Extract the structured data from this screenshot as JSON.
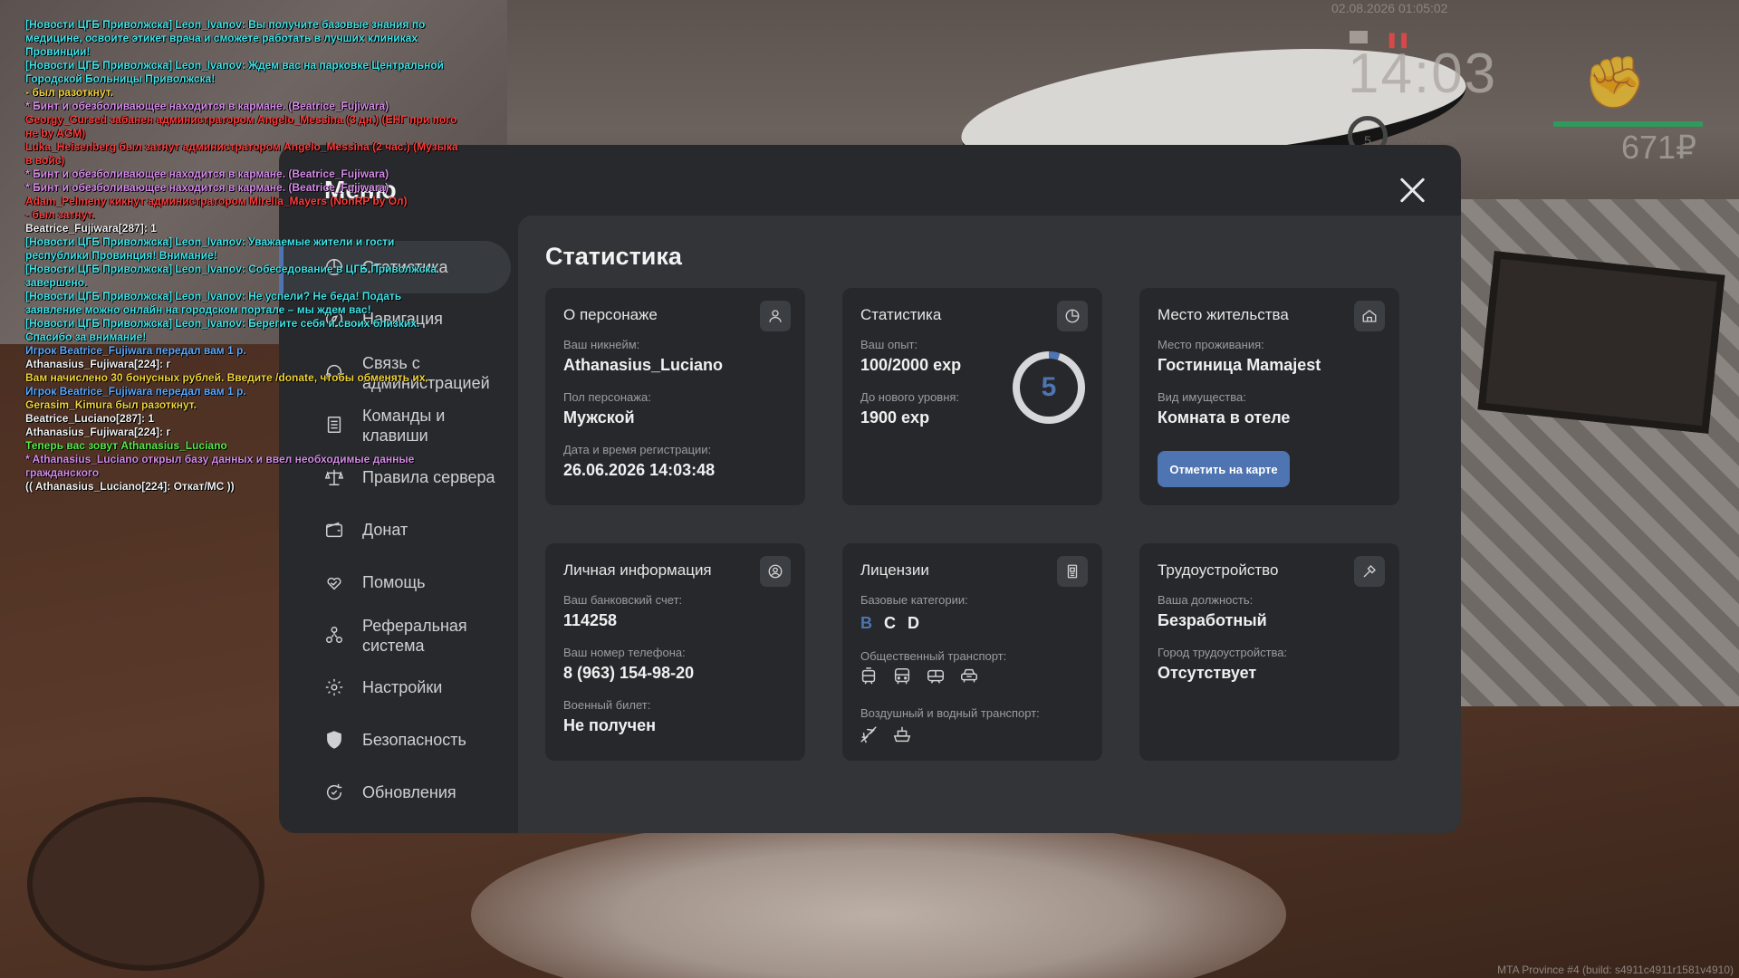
{
  "hud": {
    "datetime": "02.08.2026 01:05:02",
    "time": "14:03",
    "level": "5",
    "exp": "100/2000",
    "money": "671₽",
    "build": "MTA Province #4 (build: s4911c4911r1581v4910)"
  },
  "chat": [
    {
      "text": "[Новости ЦГБ Приволжска] Leon_Ivanov: Вы получите базовые знания по медицине, освоите этикет врача и сможете работать в лучших клиниках Провинции!",
      "color": "#3fe3e8"
    },
    {
      "text": "[Новости ЦГБ Приволжска] Leon_Ivanov: Ждем вас на парковке Центральной Городской Больницы Приволжска!",
      "color": "#3fe3e8"
    },
    {
      "text": "- был разоткнут.",
      "color": "#f2d43a"
    },
    {
      "text": "* Бинт и обезболивающее находится в кармане. (Beatrice_Fujiwara)",
      "color": "#d58be8"
    },
    {
      "text": "Georgy_Cursed забанен администратором Angelo_Messina (3 дн.) (ЕНГ при пого не by AGM)",
      "color": "#ff3b3b"
    },
    {
      "text": "Luka_Heisenberg был затнут администратором Angelo_Messina (2 час.) (Музыка в войс)",
      "color": "#ff3b3b"
    },
    {
      "text": "* Бинт и обезболивающее находится в кармане. (Beatrice_Fujiwara)",
      "color": "#d58be8"
    },
    {
      "text": "* Бинт и обезболивающее находится в кармане. (Beatrice_Fujiwara)",
      "color": "#d58be8"
    },
    {
      "text": "Adam_Pelmeny кикнут администратором Mirella_Mayers (NonRP by Ол)",
      "color": "#ff3b3b"
    },
    {
      "text": "- был затнут.",
      "color": "#ff3b3b"
    },
    {
      "text": "Beatrice_Fujiwara[287]: 1",
      "color": "#f2f2f2"
    },
    {
      "text": "[Новости ЦГБ Приволжска] Leon_Ivanov: Уважаемые жители и гости республики Провинция! Внимание!",
      "color": "#3fe3e8"
    },
    {
      "text": "[Новости ЦГБ Приволжска] Leon_Ivanov: Собеседование в ЦГБ Приволжска завершено.",
      "color": "#3fe3e8"
    },
    {
      "text": "[Новости ЦГБ Приволжска] Leon_Ivanov: Не успели? Не беда! Подать заявление можно онлайн на городском портале – мы ждем вас!",
      "color": "#3fe3e8"
    },
    {
      "text": "[Новости ЦГБ Приволжска] Leon_Ivanov: Берегите себя и своих близких. Спасибо за внимание!",
      "color": "#3fe3e8"
    },
    {
      "text": "Игрок Beatrice_Fujiwara передал вам 1 р.",
      "color": "#5aa8ff"
    },
    {
      "text": "Athanasius_Fujiwara[224]: г",
      "color": "#f2f2f2"
    },
    {
      "text": "Вам начислено 30 бонусных рублей. Введите /donate, чтобы обменять их.",
      "color": "#f2d43a"
    },
    {
      "text": "Игрок Beatrice_Fujiwara передал вам 1 р.",
      "color": "#5aa8ff"
    },
    {
      "text": "Gerasim_Kimura был разоткнут.",
      "color": "#f2d43a"
    },
    {
      "text": "Beatrice_Luciano[287]: 1",
      "color": "#f2f2f2"
    },
    {
      "text": "Athanasius_Fujiwara[224]: г",
      "color": "#f2f2f2"
    },
    {
      "text": "Теперь вас зовут Athanasius_Luciano",
      "color": "#5bea4a"
    },
    {
      "text": "* Athanasius_Luciano открыл базу данных и ввел необходимые данные гражданского",
      "color": "#d58be8"
    },
    {
      "text": "(( Athanasius_Luciano[224]: Откат/МС ))",
      "color": "#f2f2f2"
    }
  ],
  "menu": {
    "title": "Меню",
    "nav": [
      {
        "label": "Статистика",
        "icon": "pie-chart-icon",
        "active": true
      },
      {
        "label": "Навигация",
        "icon": "compass-icon"
      },
      {
        "label": "Связь с администрацией",
        "icon": "headset-icon"
      },
      {
        "label": "Команды и клавиши",
        "icon": "document-list-icon"
      },
      {
        "label": "Правила сервера",
        "icon": "scales-icon"
      },
      {
        "label": "Донат",
        "icon": "wallet-icon"
      },
      {
        "label": "Помощь",
        "icon": "heart-hand-icon"
      },
      {
        "label": "Реферальная система",
        "icon": "referral-icon"
      },
      {
        "label": "Настройки",
        "icon": "gear-icon"
      },
      {
        "label": "Безопасность",
        "icon": "shield-icon"
      },
      {
        "label": "Обновления",
        "icon": "refresh-icon"
      }
    ]
  },
  "stats": {
    "title": "Статистика",
    "character": {
      "title": "О персонаже",
      "nick_label": "Ваш никнейм:",
      "nick": "Athanasius_Luciano",
      "gender_label": "Пол персонажа:",
      "gender": "Мужской",
      "reg_label": "Дата и время регистрации:",
      "reg": "26.06.2026 14:03:48"
    },
    "statistics": {
      "title": "Статистика",
      "exp_label": "Ваш опыт:",
      "exp": "100/2000 exp",
      "next_label": "До нового уровня:",
      "next": "1900 exp",
      "level": "5",
      "progress": 0.05
    },
    "residence": {
      "title": "Место жительства",
      "place_label": "Место проживания:",
      "place": "Гостиница Mamajest",
      "type_label": "Вид имущества:",
      "type": "Комната в отеле",
      "button": "Отметить на карте"
    },
    "personal": {
      "title": "Личная информация",
      "bank_label": "Ваш банковский счет:",
      "bank": "114258",
      "phone_label": "Ваш номер телефона:",
      "phone": "8 (963) 154-98-20",
      "military_label": "Военный билет:",
      "military": "Не получен"
    },
    "licenses": {
      "title": "Лицензии",
      "base_label": "Базовые категории:",
      "categories": [
        "B",
        "C",
        "D"
      ],
      "public_label": "Общественный транспорт:",
      "air_label": "Воздушный и водный транспорт:"
    },
    "employment": {
      "title": "Трудоустройство",
      "position_label": "Ваша должность:",
      "position": "Безработный",
      "city_label": "Город трудоустройства:",
      "city": "Отсутствует"
    }
  },
  "colors": {
    "accent": "#4f74b2",
    "panel": "#27292c",
    "card": "#26282b"
  }
}
